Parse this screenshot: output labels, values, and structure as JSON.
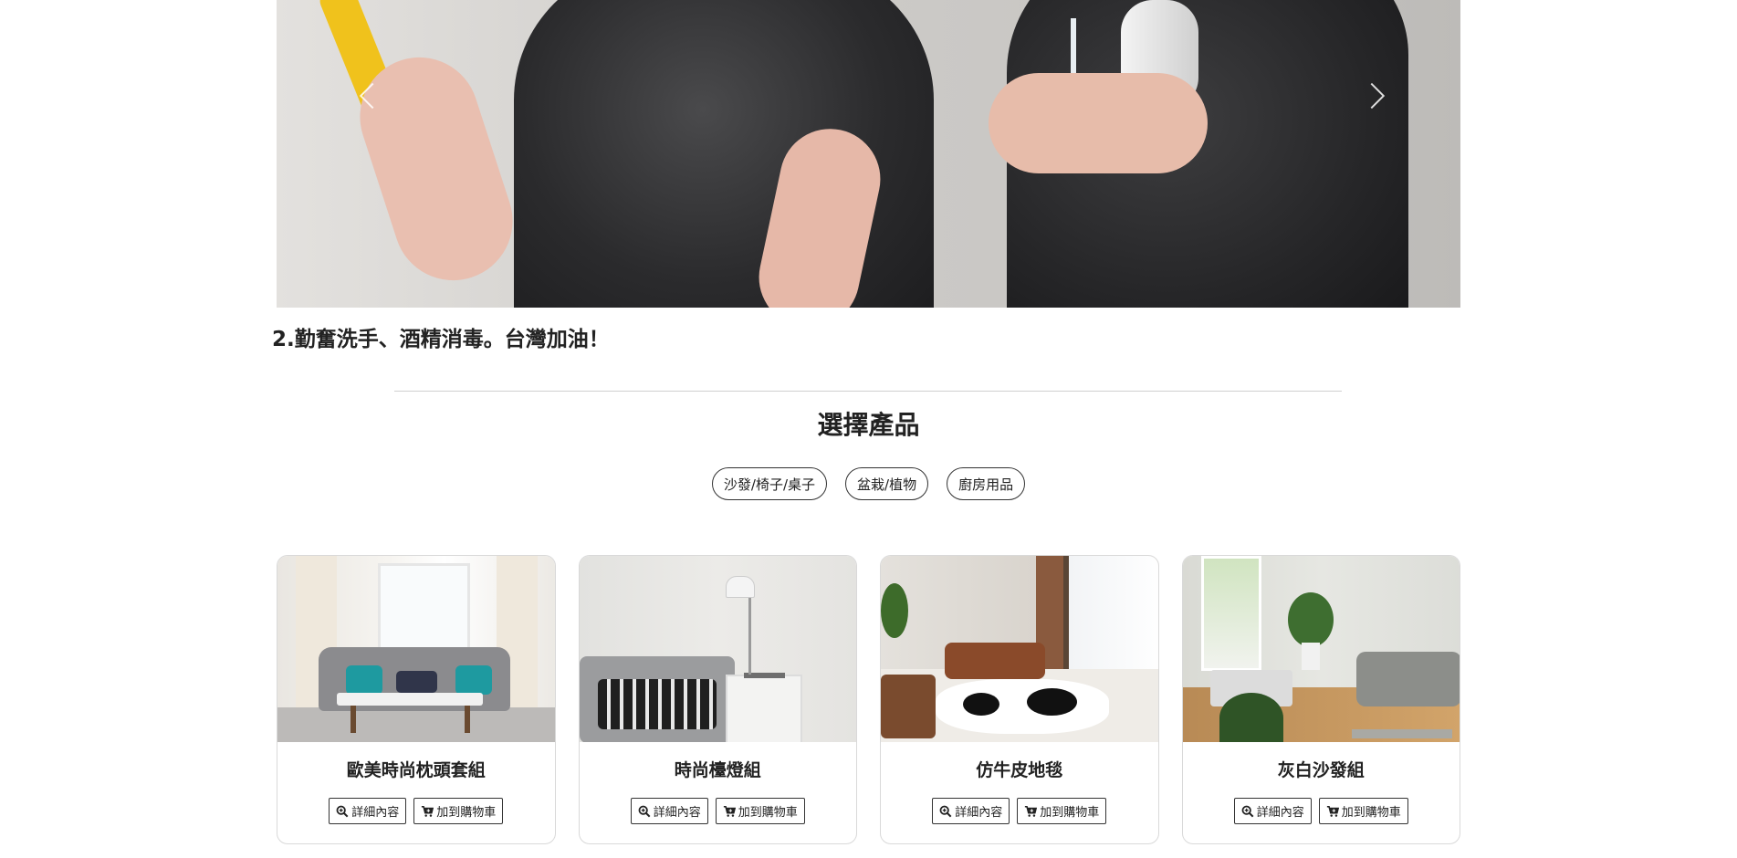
{
  "hero": {
    "caption": "2.勤奮洗手、酒精消毒。台灣加油！"
  },
  "products_section": {
    "title": "選擇產品",
    "filters": [
      "沙發/椅子/桌子",
      "盆栽/植物",
      "廚房用品"
    ]
  },
  "products": [
    {
      "name": "歐美時尚枕頭套組",
      "detail_label": "詳細內容",
      "cart_label": "加到購物車"
    },
    {
      "name": "時尚檯燈組",
      "detail_label": "詳細內容",
      "cart_label": "加到購物車"
    },
    {
      "name": "仿牛皮地毯",
      "detail_label": "詳細內容",
      "cart_label": "加到購物車"
    },
    {
      "name": "灰白沙發組",
      "detail_label": "詳細內容",
      "cart_label": "加到購物車"
    }
  ],
  "icons": {
    "detail": "zoom-in-icon",
    "cart": "cart-plus-icon",
    "carousel_prev": "chevron-left-icon",
    "carousel_next": "chevron-right-icon"
  }
}
